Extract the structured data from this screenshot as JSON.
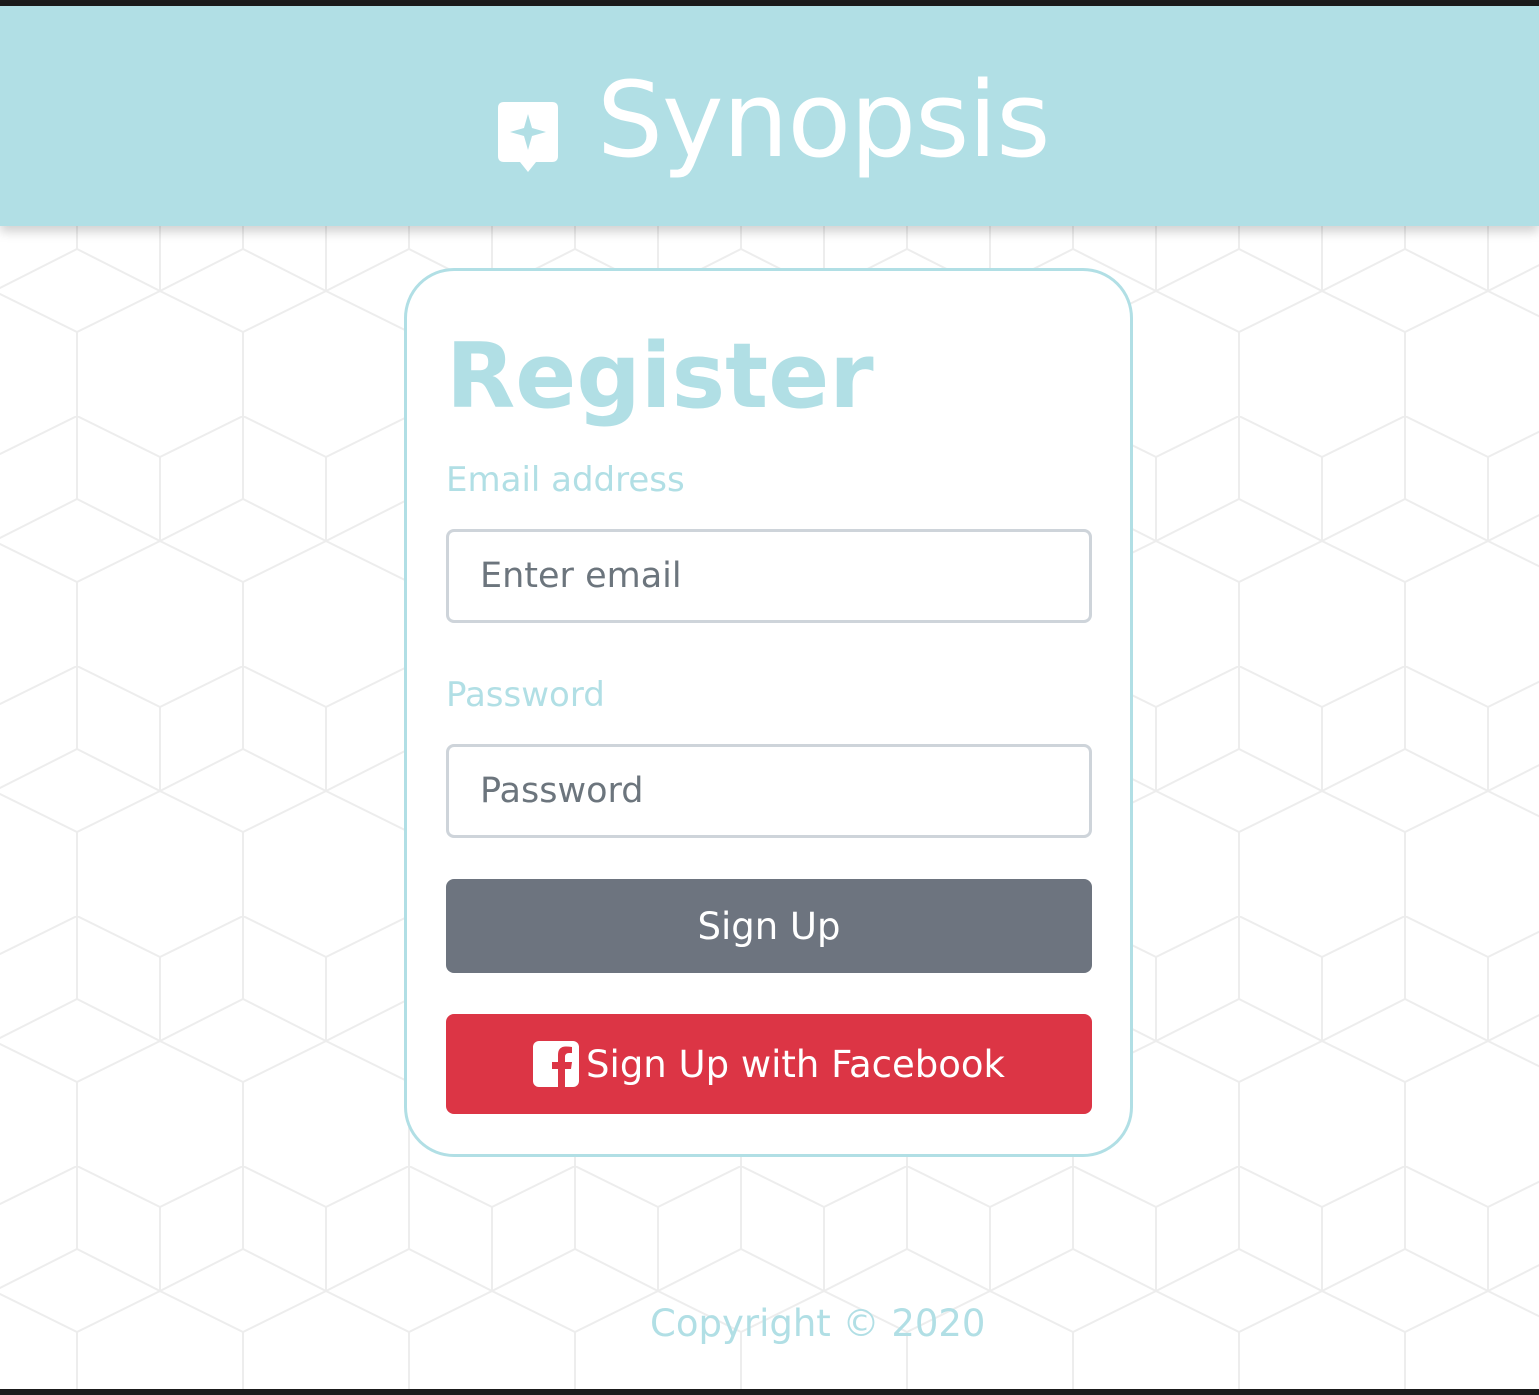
{
  "header": {
    "brand_name": "Synopsis",
    "brand_icon": "sparkle-speech-bubble-icon"
  },
  "register_form": {
    "title": "Register",
    "email_label": "Email address",
    "email_placeholder": "Enter email",
    "email_value": "",
    "password_label": "Password",
    "password_placeholder": "Password",
    "password_value": "",
    "signup_label": "Sign Up",
    "facebook_label": "Sign Up with Facebook",
    "facebook_icon": "facebook-icon"
  },
  "footer": {
    "copyright": "Copyright © 2020"
  },
  "colors": {
    "accent": "#b1dfe5",
    "signup_button": "#6d747f",
    "facebook_button": "#dc3545",
    "input_border": "#ced4da",
    "placeholder_text": "#6c757d"
  }
}
